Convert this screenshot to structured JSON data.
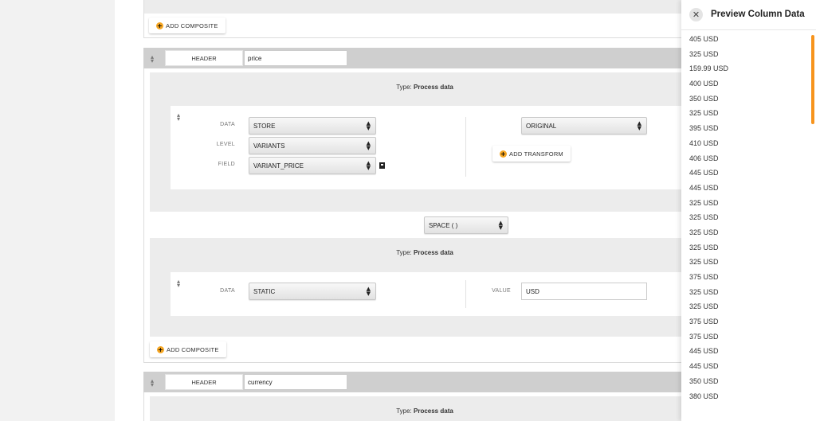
{
  "composite_top": {
    "add_label": "ADD COMPOSITE"
  },
  "header_price": {
    "label": "HEADER",
    "value": "price"
  },
  "block1": {
    "type_label": "Type:",
    "type_value": "Process data",
    "data_label": "DATA",
    "data_value": "STORE",
    "level_label": "LEVEL",
    "level_value": "VARIANTS",
    "field_label": "FIELD",
    "field_value": "VARIANT_PRICE",
    "original_value": "ORIGINAL",
    "add_transform_label": "ADD TRANSFORM"
  },
  "separator": {
    "value": "SPACE ( )"
  },
  "block2": {
    "type_label": "Type:",
    "type_value": "Process data",
    "data_label": "DATA",
    "data_value": "STATIC",
    "value_label": "VALUE",
    "value_value": "USD"
  },
  "composite_mid": {
    "add_label": "ADD COMPOSITE"
  },
  "header_currency": {
    "label": "HEADER",
    "value": "currency"
  },
  "block3": {
    "type_label": "Type:",
    "type_value": "Process data"
  },
  "preview": {
    "title": "Preview Column Data",
    "close_icon": "close-icon",
    "values": [
      "405 USD",
      "325 USD",
      "159.99 USD",
      "400 USD",
      "350 USD",
      "325 USD",
      "395 USD",
      "410 USD",
      "406 USD",
      "445 USD",
      "445 USD",
      "325 USD",
      "325 USD",
      "325 USD",
      "325 USD",
      "325 USD",
      "375 USD",
      "325 USD",
      "325 USD",
      "375 USD",
      "375 USD",
      "445 USD",
      "445 USD",
      "350 USD",
      "380 USD"
    ],
    "accent_color": "#f7941d"
  }
}
